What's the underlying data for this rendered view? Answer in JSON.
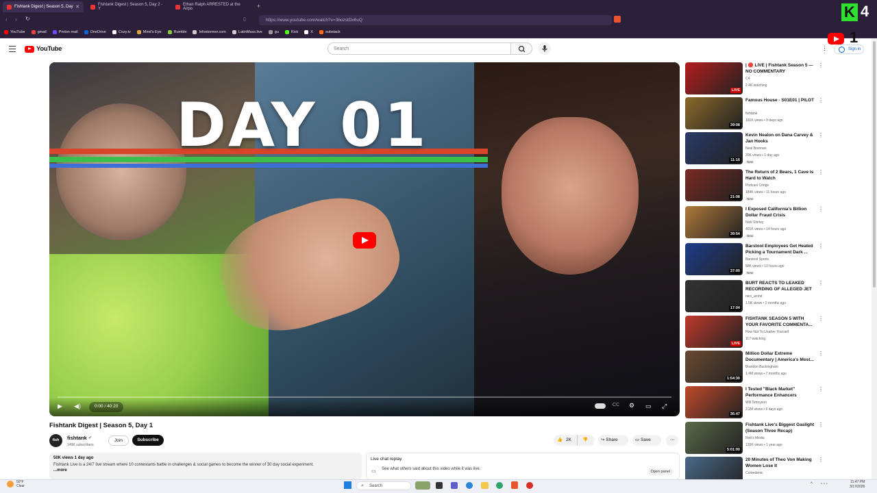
{
  "browser": {
    "tabs": [
      {
        "title": "Fishtank Digest | Season 5, Day",
        "active": true
      },
      {
        "title": "Fishtank Digest | Season 5, Day 2 - Y",
        "active": false
      },
      {
        "title": "Ethan Ralph ARRESTED at the Airpo",
        "active": false
      }
    ],
    "url": "https://www.youtube.com/watch?v=3bozstDx6uQ",
    "bookmarks": [
      {
        "label": "YouTube",
        "color": "#ff0000"
      },
      {
        "label": "gmail",
        "color": "#ea4335"
      },
      {
        "label": "Proton mail",
        "color": "#6d4aff"
      },
      {
        "label": "OneDrive",
        "color": "#0a64d6"
      },
      {
        "label": "Cozy.tv",
        "color": "#ffffff"
      },
      {
        "label": "Mind's Eye",
        "color": "#d9a441"
      },
      {
        "label": "Rumble",
        "color": "#85c742"
      },
      {
        "label": "Infostormer.com",
        "color": "#cccccc"
      },
      {
        "label": "LatinMass.live",
        "color": "#cccccc"
      },
      {
        "label": "gu",
        "color": "#999999"
      },
      {
        "label": "Kick",
        "color": "#53fc18"
      },
      {
        "label": "X",
        "color": "#ffffff"
      },
      {
        "label": "substack",
        "color": "#ff6719"
      }
    ]
  },
  "youtube": {
    "logo_text": "YouTube",
    "search_placeholder": "Search",
    "signin_label": "Sign in"
  },
  "video": {
    "thumbnail_text": "DAY 01",
    "time": "0:00 / 40:20",
    "title": "Fishtank Digest | Season 5, Day 1",
    "channel": "fishtank",
    "avatar_text": "fish",
    "subscribers": "149K subscribers",
    "join_label": "Join",
    "subscribe_label": "Subscribe",
    "likes": "2K",
    "share_label": "Share",
    "save_label": "Save",
    "meta": "50K views  1 day ago",
    "description": "Fishtank Live is a 24/7 live stream where 10 contestants battle in challenges & social games to become the winner of 30 day social experiment.",
    "more_label": "...more",
    "live_chat_title": "Live chat replay",
    "live_chat_text": "See what others said about this video while it was live.",
    "open_panel_label": "Open panel"
  },
  "recommendations": [
    {
      "title": "| 🔴 LIVE | Fishtank Season 5 — NO COMMENTARY",
      "channel": "C4",
      "stats": "2.4K watching",
      "badge": "LIVE",
      "new": "",
      "thumb": "#b51d1d"
    },
    {
      "title": "Famous House - S01E01 | PILOT",
      "channel": "fishtank",
      "stats": "191K views • 9 days ago",
      "badge": "39:08",
      "new": "",
      "thumb": "#8a6a2a"
    },
    {
      "title": "Kevin Nealon on Dana Carvey & Jan Hooks",
      "channel": "Neal Brennan",
      "stats": "20K views • 1 day ago",
      "badge": "11:16",
      "new": "New",
      "thumb": "#2a3b6a"
    },
    {
      "title": "The Return of 2 Bears, 1 Cave Is Hard to Watch",
      "channel": "Podcast Cringe",
      "stats": "184K views • 11 hours ago",
      "badge": "21:08",
      "new": "New",
      "thumb": "#7a2a22"
    },
    {
      "title": "I Exposed California's Billion Dollar Fraud Crisis",
      "channel": "Nick Shirley",
      "stats": "401K views • 14 hours ago",
      "badge": "39:54",
      "new": "New",
      "thumb": "#b07a3a"
    },
    {
      "title": "Barstool Employees Get Heated Picking a Tournament Dark ...",
      "channel": "Barstool Sports",
      "stats": "56K views • 13 hours ago",
      "badge": "37:00",
      "new": "New",
      "thumb": "#1d3d8a"
    },
    {
      "title": "BURT REACTS TO LEAKED RECORDING OF ALLEGED JET ...",
      "channel": "nico_archd",
      "stats": "1.5K views • 2 months ago",
      "badge": "17:04",
      "new": "",
      "thumb": "#333333"
    },
    {
      "title": "FISHTANK SEASON 5 WITH YOUR FAVORITE COMMENTA...",
      "channel": "How Not To Unalive Yourself",
      "stats": "117 watching",
      "badge": "LIVE",
      "new": "",
      "thumb": "#c0392b"
    },
    {
      "title": "Million Dollar Extreme Documentary | America's Most...",
      "channel": "Brandon Buckingham",
      "stats": "1.4M views • 7 months ago",
      "badge": "1:54:30",
      "new": "",
      "thumb": "#6a4a32"
    },
    {
      "title": "I Tested \"Black Market\" Performance Enhancers",
      "channel": "Will Tennyson",
      "stats": "2.2M views • 9 days ago",
      "badge": "36:47",
      "new": "",
      "thumb": "#c04a2a"
    },
    {
      "title": "Fishtank Live's Biggest Gaslight (Season Three Recap)",
      "channel": "Rob's Media",
      "stats": "135K views • 1 year ago",
      "badge": "5:01:00",
      "new": "",
      "thumb": "#5a6a4a"
    },
    {
      "title": "20 Minutes of Theo Von Making Women Lose It",
      "channel": "Comedenic",
      "stats": "",
      "badge": "",
      "new": "",
      "thumb": "#4a6a8a"
    }
  ],
  "taskbar": {
    "weather_temp": "50°F",
    "weather_text": "Clear",
    "search_label": "Search",
    "time": "11:47 PM",
    "date": "3/17/2026"
  },
  "overlay": {
    "k_label": "K",
    "k_count": "4",
    "yt_count": "1"
  }
}
